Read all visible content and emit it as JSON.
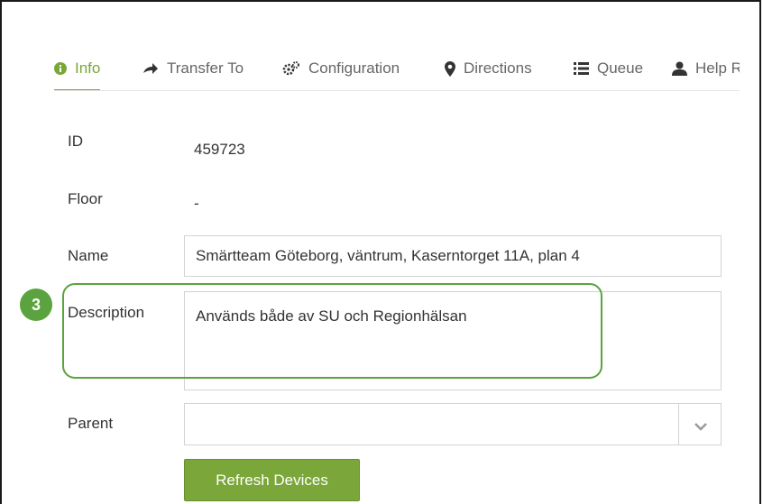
{
  "tabs": [
    {
      "label": "Info",
      "icon": "info-icon",
      "active": true
    },
    {
      "label": "Transfer To",
      "icon": "arrow-right-icon",
      "active": false
    },
    {
      "label": "Configuration",
      "icon": "gears-icon",
      "active": false
    },
    {
      "label": "Directions",
      "icon": "map-marker-icon",
      "active": false
    },
    {
      "label": "Queue",
      "icon": "list-icon",
      "active": false
    },
    {
      "label": "Help Re",
      "icon": "user-icon",
      "active": false
    }
  ],
  "fields": {
    "id_label": "ID",
    "id_value": "459723",
    "floor_label": "Floor",
    "floor_value": "-",
    "name_label": "Name",
    "name_value": "Smärtteam Göteborg, väntrum, Kaserntorget 11A, plan 4",
    "description_label": "Description",
    "description_value": "Används både av SU och Regionhälsan",
    "parent_label": "Parent",
    "parent_value": ""
  },
  "buttons": {
    "refresh_label": "Refresh Devices"
  },
  "annotation": {
    "badge_number": "3",
    "color": "#5aa33e"
  },
  "colors": {
    "accent": "#7aa63a",
    "annotation": "#5aa33e"
  }
}
